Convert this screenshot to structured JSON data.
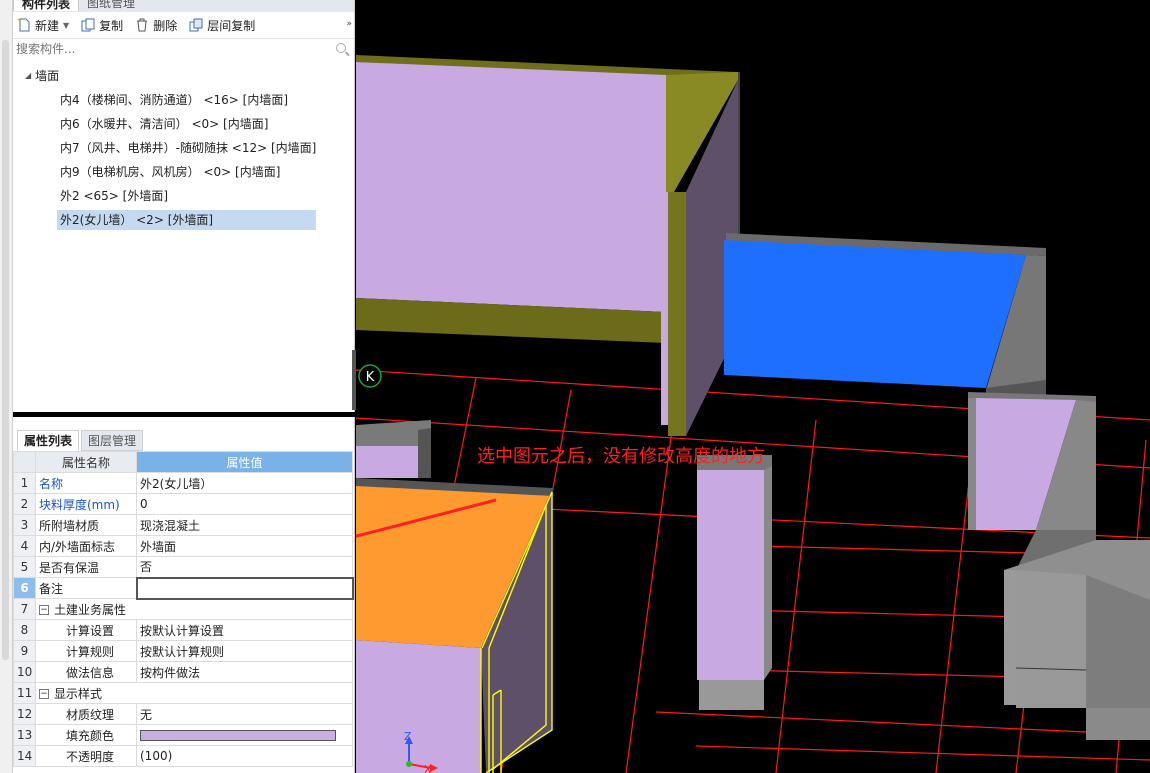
{
  "left_panel": {
    "tabs": [
      "构件列表",
      "图纸管理"
    ],
    "toolbar": {
      "new_label": "新建",
      "copy_label": "复制",
      "delete_label": "删除",
      "floor_copy_label": "层间复制",
      "more": "»"
    },
    "search_placeholder": "搜索构件...",
    "tree": {
      "root_label": "墙面",
      "items": [
        "内4（楼梯间、消防通道） <16> [内墙面]",
        "内6（水暖井、清洁间） <0> [内墙面]",
        "内7（风井、电梯井）-随砌随抹 <12> [内墙面]",
        "内9（电梯机房、风机房） <0> [内墙面]",
        "外2 <65> [外墙面]",
        "外2(女儿墙） <2> [外墙面]"
      ],
      "selected_index": 5
    }
  },
  "properties": {
    "tabs": [
      "属性列表",
      "图层管理"
    ],
    "close": "×",
    "headers": {
      "name": "属性名称",
      "value": "属性值"
    },
    "rows": [
      {
        "num": "1",
        "name": "名称",
        "value": "外2(女儿墙）"
      },
      {
        "num": "2",
        "name": "块料厚度(mm)",
        "value": "0"
      },
      {
        "num": "3",
        "name": "所附墙材质",
        "value": "现浇混凝土"
      },
      {
        "num": "4",
        "name": "内/外墙面标志",
        "value": "外墙面"
      },
      {
        "num": "5",
        "name": "是否有保温",
        "value": "否"
      },
      {
        "num": "6",
        "name": "备注",
        "value": ""
      },
      {
        "num": "7",
        "name": "土建业务属性",
        "value": ""
      },
      {
        "num": "8",
        "name": "计算设置",
        "value": "按默认计算设置"
      },
      {
        "num": "9",
        "name": "计算规则",
        "value": "按默认计算规则"
      },
      {
        "num": "10",
        "name": "做法信息",
        "value": "按构件做法"
      },
      {
        "num": "11",
        "name": "显示样式",
        "value": ""
      },
      {
        "num": "12",
        "name": "材质纹理",
        "value": "无"
      },
      {
        "num": "13",
        "name": "填充颜色",
        "value": ""
      },
      {
        "num": "14",
        "name": "不透明度",
        "value": "(100)"
      }
    ],
    "fill_color": "#c9aee0"
  },
  "viewport": {
    "annotation": "选中图元之后，没有修改高度的地方",
    "snap_marker": "K",
    "axis_z": "Z",
    "axis_x": "X",
    "colors": {
      "background": "#000000",
      "grid": "#ff1a1a",
      "wall_face": "#c8a9e2",
      "wall_top": "#6b6b1a",
      "selected_floor": "#ff9a30",
      "blue_face": "#1f6fff",
      "grey_wall": "#8a8a8a",
      "annotation": "#ff2020"
    }
  }
}
